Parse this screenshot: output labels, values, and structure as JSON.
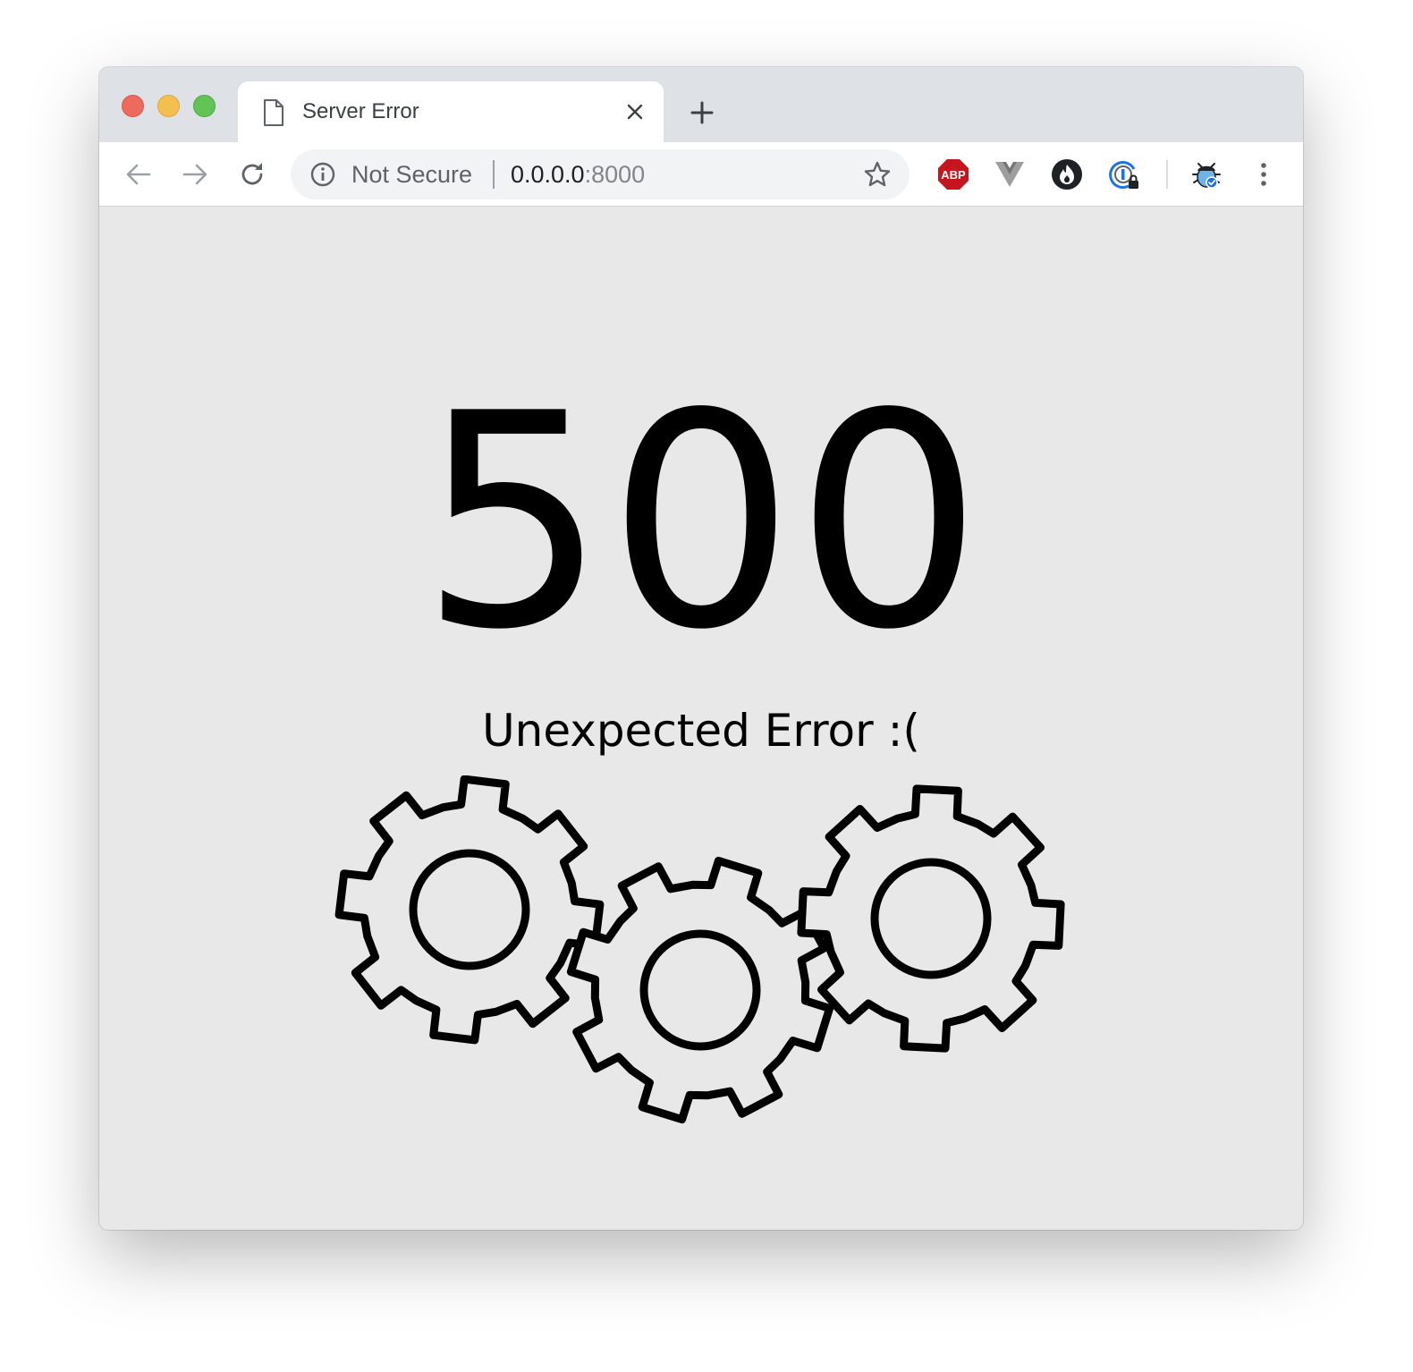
{
  "browser": {
    "tab": {
      "title": "Server Error",
      "icon": "document-icon"
    },
    "address_bar": {
      "security_label": "Not Secure",
      "url_host": "0.0.0.0",
      "url_port": ":8000"
    },
    "extensions": [
      "adblock-plus-icon",
      "vue-devtools-icon",
      "fire-extension-icon",
      "password-manager-icon",
      "bug-extension-icon"
    ],
    "extension_labels": {
      "abp": "ABP"
    }
  },
  "page": {
    "status_code": "500",
    "message": "Unexpected Error :("
  },
  "colors": {
    "tabstrip": "#dee1e6",
    "page_background": "#e8e8e8",
    "close_button": "#ed6a5e",
    "minimize_button": "#f5bf4f",
    "maximize_button": "#61c454",
    "abp_red": "#c4161c"
  }
}
